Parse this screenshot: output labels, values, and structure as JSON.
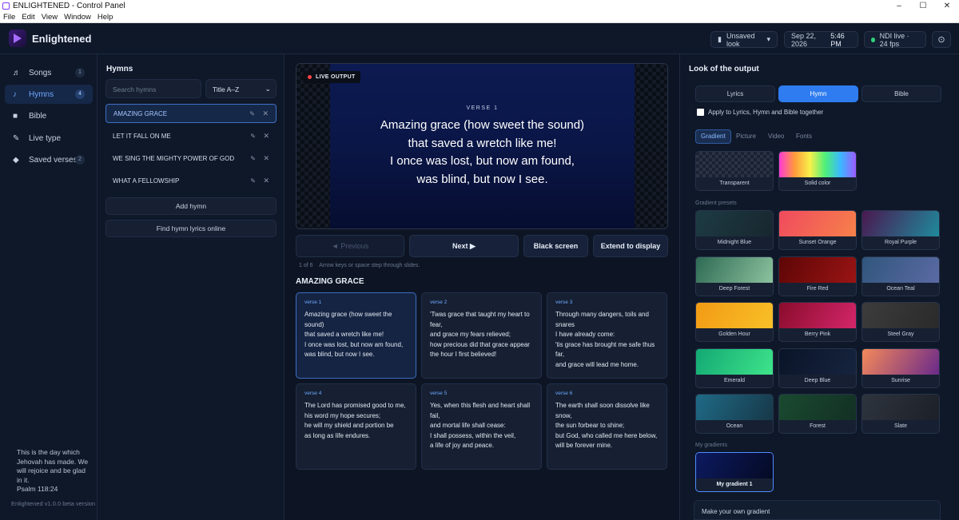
{
  "window": {
    "title": "ENLIGHTENED - Control Panel",
    "controls": [
      "–",
      "☐",
      "✕"
    ]
  },
  "menu": [
    "File",
    "Edit",
    "View",
    "Window",
    "Help"
  ],
  "header": {
    "app_name": "Enlightened",
    "look_label": "Unsaved look",
    "look_chevron": "▾",
    "date": "Sep 22, 2026",
    "time": "5:46 PM",
    "ndi": "NDI live · 24 fps",
    "settings_glyph": "⊙"
  },
  "sidebar": {
    "items": [
      {
        "label": "Songs",
        "icon": "music-note-icon",
        "glyph": "♬",
        "count": "1"
      },
      {
        "label": "Hymns",
        "icon": "note-icon",
        "glyph": "♪",
        "count": "4"
      },
      {
        "label": "Bible",
        "icon": "book-icon",
        "glyph": "■",
        "count": ""
      },
      {
        "label": "Live type",
        "icon": "pencil-icon",
        "glyph": "✎",
        "count": ""
      },
      {
        "label": "Saved verses",
        "icon": "bookmark-icon",
        "glyph": "◆",
        "count": "2"
      }
    ],
    "quote": "This is the day which Jehovah has made. We will rejoice and be glad in it.",
    "quote_ref": "Psalm 118:24",
    "version": "Enlightened v1.0.0 beta version"
  },
  "hymns": {
    "title": "Hymns",
    "search_placeholder": "Search hymns",
    "sort": "Title A–Z",
    "sort_chevron": "⌄",
    "edit_glyph": "✎",
    "delete_glyph": "✕",
    "list": [
      "AMAZING GRACE",
      "LET IT FALL ON ME",
      "WE SING THE MIGHTY POWER OF GOD",
      "WHAT A FELLOWSHIP"
    ],
    "add_label": "Add hymn",
    "find_label": "Find hymn lyrics online"
  },
  "preview": {
    "badge": "LIVE OUTPUT",
    "verse_label": "VERSE 1",
    "lines": [
      "Amazing grace (how sweet the sound)",
      "that saved a wretch like me!",
      "I once was lost, but now am found,",
      "was blind, but now I see."
    ]
  },
  "controls": {
    "previous": "◄  Previous",
    "next": "Next  ▶",
    "black": "Black screen",
    "extend": "Extend to display",
    "position": "1 of 6",
    "hint": "Arrow keys or space step through slides."
  },
  "song": {
    "title": "AMAZING GRACE",
    "verses": [
      {
        "label": "verse 1",
        "text": "Amazing grace (how sweet the sound)\nthat saved a wretch like me!\nI once was lost, but now am found,\nwas blind, but now I see."
      },
      {
        "label": "verse 2",
        "text": "'Twas grace that taught my heart to fear,\nand grace my fears relieved;\nhow precious did that grace appear\nthe hour I first believed!"
      },
      {
        "label": "verse 3",
        "text": "Through many dangers, toils and snares\nI have already come:\n'tis grace has brought me safe thus far,\nand grace will lead me home."
      },
      {
        "label": "verse 4",
        "text": "The Lord has promised good to me,\nhis word my hope secures;\nhe will my shield and portion be\nas long as life endures."
      },
      {
        "label": "verse 5",
        "text": "Yes, when this flesh and heart shall fail,\nand mortal life shall cease:\nI shall possess, within the veil,\na life of joy and peace."
      },
      {
        "label": "verse 6",
        "text": "The earth shall soon dissolve like snow,\nthe sun forbear to shine;\nbut God, who called me here below,\nwill be forever mine."
      }
    ]
  },
  "look": {
    "title": "Look of the output",
    "segments": [
      "Lyrics",
      "Hymn",
      "Bible"
    ],
    "apply_all": "Apply to Lyrics, Hymn and Bible together",
    "tabs": [
      "Gradient",
      "Picture",
      "Video",
      "Fonts"
    ],
    "base": [
      {
        "name": "Transparent"
      },
      {
        "name": "Solid color"
      }
    ],
    "presets_label": "Gradient presets",
    "presets": [
      {
        "name": "Midnight Blue",
        "c1": "#1d3b44",
        "c2": "#18262e"
      },
      {
        "name": "Sunset Orange",
        "c1": "#f04a5e",
        "c2": "#f6814a"
      },
      {
        "name": "Royal Purple",
        "c1": "#4a1850",
        "c2": "#1f8a9c"
      },
      {
        "name": "Deep Forest",
        "c1": "#2e6a54",
        "c2": "#8cc29e"
      },
      {
        "name": "Fire Red",
        "c1": "#5e0606",
        "c2": "#9a1414"
      },
      {
        "name": "Ocean Teal",
        "c1": "#30567c",
        "c2": "#5b6aa4"
      },
      {
        "name": "Golden Hour",
        "c1": "#f29a14",
        "c2": "#f8c028"
      },
      {
        "name": "Berry Pink",
        "c1": "#8a0c2c",
        "c2": "#d4266a"
      },
      {
        "name": "Steel Gray",
        "c1": "#3c3c3c",
        "c2": "#2a2a2a"
      },
      {
        "name": "Emerald",
        "c1": "#13a874",
        "c2": "#3ee48a"
      },
      {
        "name": "Deep Blue",
        "c1": "#0a1428",
        "c2": "#16243e"
      },
      {
        "name": "Sunrise",
        "c1": "#f4885a",
        "c2": "#6a2a8a"
      },
      {
        "name": "Ocean",
        "c1": "#1f6a86",
        "c2": "#173848"
      },
      {
        "name": "Forest",
        "c1": "#1a4a30",
        "c2": "#133024"
      },
      {
        "name": "Slate",
        "c1": "#2e343e",
        "c2": "#1c2028"
      }
    ],
    "my_label": "My gradients",
    "my": [
      {
        "name": "My gradient 1",
        "c1": "#0c1a60",
        "c2": "#050a24"
      }
    ],
    "make_label": "Make your own gradient"
  },
  "colors": {
    "accent": "#2f7cf0",
    "live_dot": "#ff4545",
    "ndi_dot": "#2fd27a"
  }
}
